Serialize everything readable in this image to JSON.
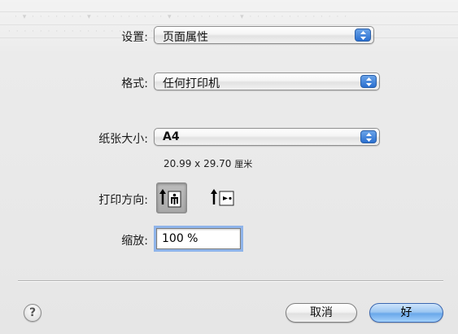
{
  "page_setup": {
    "settings": {
      "label": "设置:",
      "value": "页面属性"
    },
    "format": {
      "label": "格式:",
      "value": "任何打印机"
    },
    "paper_size": {
      "label": "纸张大小:",
      "value": "A4",
      "dimensions": "20.99 x 29.70",
      "unit": "厘米"
    },
    "orientation": {
      "label": "打印方向:",
      "options": [
        {
          "name": "portrait",
          "selected": true
        },
        {
          "name": "landscape",
          "selected": false
        }
      ]
    },
    "scale": {
      "label": "缩放:",
      "value": "100 %"
    }
  },
  "buttons": {
    "help_label": "?",
    "cancel_label": "取消",
    "ok_label": "好"
  },
  "colors": {
    "accent": "#6aa8ea",
    "popup_arrow": "#2a6fd0",
    "focus_ring": "#8fb4ea"
  }
}
